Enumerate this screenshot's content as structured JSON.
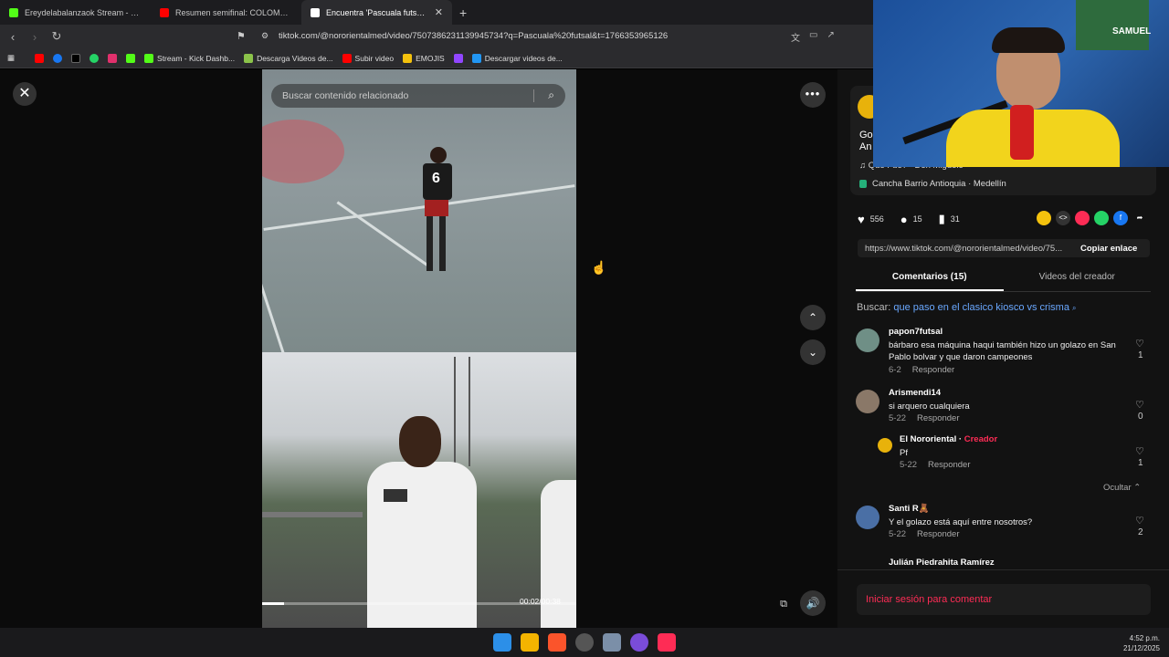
{
  "browser": {
    "tabs": [
      {
        "title": "Ereydelabalanzaok Stream - Watch L",
        "color": "#53fc18",
        "active": false
      },
      {
        "title": "Resumen semifinal: COLOMBIA VS BR",
        "color": "#ff0000",
        "active": false
      },
      {
        "title": "Encuentra 'Pascuala futsal' en",
        "color": "#ffffff",
        "active": true
      }
    ],
    "new_tab": "+",
    "url": "tiktok.com/@nororientalmed/video/7507386231139945734?q=Pascuala%20futsal&t=1766353965126",
    "bookmarks": [
      {
        "label": "",
        "color": "#ff0000"
      },
      {
        "label": "",
        "color": "#1877f2"
      },
      {
        "label": "",
        "color": "#000000"
      },
      {
        "label": "",
        "color": "#25d366"
      },
      {
        "label": "",
        "color": "#e1306c"
      },
      {
        "label": "",
        "color": "#53fc18"
      },
      {
        "label": "Stream - Kick Dashb...",
        "color": "#53fc18"
      },
      {
        "label": "Descarga Videos de...",
        "color": "#8bc34a"
      },
      {
        "label": "Subir video",
        "color": "#ff0000"
      },
      {
        "label": "EMOJIS",
        "color": "#f4c20d"
      },
      {
        "label": "Descargar videos de...",
        "color": "#2196f3"
      }
    ]
  },
  "player": {
    "close": "✕",
    "search_placeholder": "Buscar contenido relacionado",
    "more": "•••",
    "time": "00:02/00:38",
    "progress": 0.07
  },
  "info": {
    "description": "Go\nAn",
    "music": "♫ Que Fue? - Don Miguelo",
    "location": "Cancha Barrio Antioquia · Medellín"
  },
  "stats": {
    "likes": "556",
    "comments": "15",
    "saves": "31"
  },
  "link": {
    "url": "https://www.tiktok.com/@nororientalmed/video/75...",
    "copy": "Copiar enlace"
  },
  "tabs": {
    "comments": "Comentarios (15)",
    "creator_videos": "Videos del creador"
  },
  "search_suggest": {
    "label": "Buscar:",
    "query": "que paso en el clasico kiosco vs crisma"
  },
  "comments": [
    {
      "user": "papon7futsal",
      "text": "bárbaro esa máquina haqui también hizo un golazo en San Pablo bolvar y que daron campeones",
      "date": "6-2",
      "reply": "Responder",
      "likes": "1"
    },
    {
      "user": "Arismendi14",
      "text": "si arquero cualquiera",
      "date": "5-22",
      "reply": "Responder",
      "likes": "0"
    },
    {
      "user": "El Nororiental",
      "badge": "Creador",
      "text": "Pf",
      "date": "5-22",
      "reply": "Responder",
      "likes": "1"
    },
    {
      "user": "Santi R🧸",
      "text": "Y el golazo está aquí entre nosotros?",
      "date": "5-22",
      "reply": "Responder",
      "likes": "2"
    },
    {
      "user": "Julián Piedrahita Ramírez",
      "text": "",
      "date": "",
      "reply": "",
      "likes": ""
    }
  ],
  "hide_label": "Ocultar ⌃",
  "login": "Iniciar sesión para comentar",
  "clock": {
    "time": "4:52 p.m.",
    "date": "21/12/2025"
  },
  "webcam": {
    "poster_text": "SAMUEL"
  }
}
